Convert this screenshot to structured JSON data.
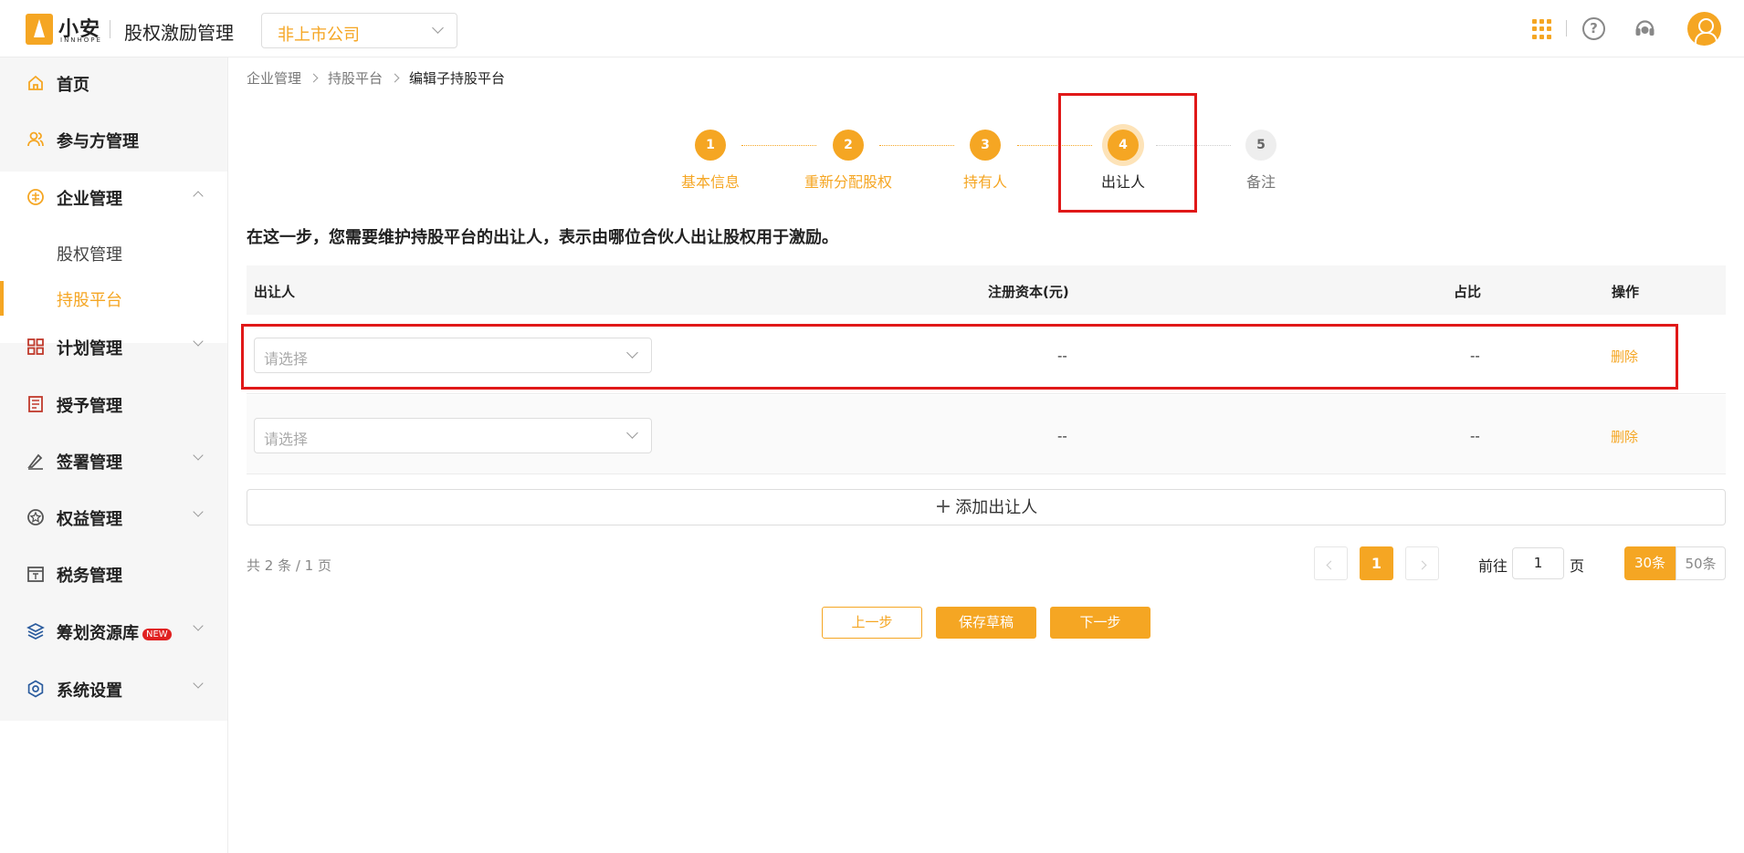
{
  "header": {
    "brand": "小安",
    "brand_sub": "INNHOPE",
    "app_title": "股权激励管理",
    "company_select": "非上市公司",
    "help_glyph": "?"
  },
  "sidebar": {
    "items": [
      {
        "label": "首页",
        "icon": "home-icon"
      },
      {
        "label": "参与方管理",
        "icon": "users-icon"
      },
      {
        "label": "企业管理",
        "icon": "enterprise-icon",
        "expanded": true,
        "children": [
          {
            "label": "股权管理"
          },
          {
            "label": "持股平台",
            "active": true
          }
        ]
      },
      {
        "label": "计划管理",
        "icon": "grid-icon"
      },
      {
        "label": "授予管理",
        "icon": "document-icon"
      },
      {
        "label": "签署管理",
        "icon": "signature-icon"
      },
      {
        "label": "权益管理",
        "icon": "badge-icon"
      },
      {
        "label": "税务管理",
        "icon": "tax-icon"
      },
      {
        "label": "筹划资源库",
        "icon": "layers-icon",
        "badge": "NEW"
      },
      {
        "label": "系统设置",
        "icon": "settings-icon"
      }
    ]
  },
  "breadcrumb": [
    "企业管理",
    "持股平台",
    "编辑子持股平台"
  ],
  "steps": [
    {
      "num": "1",
      "label": "基本信息",
      "state": "done"
    },
    {
      "num": "2",
      "label": "重新分配股权",
      "state": "done"
    },
    {
      "num": "3",
      "label": "持有人",
      "state": "done"
    },
    {
      "num": "4",
      "label": "出让人",
      "state": "current"
    },
    {
      "num": "5",
      "label": "备注",
      "state": "todo"
    }
  ],
  "description": "在这一步，您需要维护持股平台的出让人，表示由哪位合伙人出让股权用于激励。",
  "table": {
    "headers": {
      "transferor": "出让人",
      "capital": "注册资本(元)",
      "ratio": "占比",
      "actions": "操作"
    },
    "rows": [
      {
        "placeholder": "请选择",
        "capital": "--",
        "ratio": "--",
        "action": "删除"
      },
      {
        "placeholder": "请选择",
        "capital": "--",
        "ratio": "--",
        "action": "删除"
      }
    ]
  },
  "add_button": "添加出让人",
  "pagination": {
    "total_text": "共 2 条 / 1 页",
    "current_page": "1",
    "goto_label": "前往",
    "goto_value": "1",
    "page_unit": "页",
    "sizes": [
      "30条",
      "50条"
    ]
  },
  "footer_buttons": {
    "prev": "上一步",
    "save": "保存草稿",
    "next": "下一步"
  },
  "colors": {
    "accent": "#f5a623",
    "highlight": "#e01818"
  }
}
